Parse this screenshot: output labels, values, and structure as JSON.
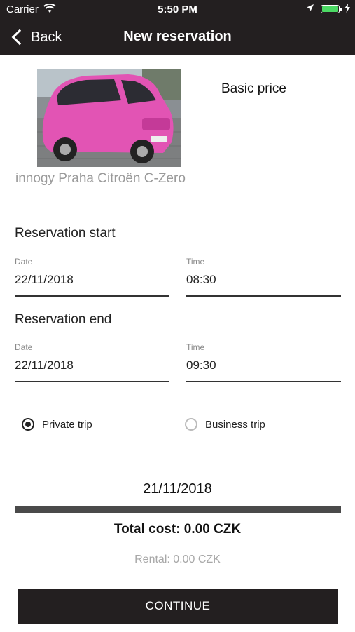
{
  "status_bar": {
    "carrier": "Carrier",
    "time": "5:50 PM",
    "battery_color": "#4cd964",
    "wifi_icon": "wifi-icon",
    "location_icon": "location-arrow-icon",
    "charging_icon": "bolt-icon"
  },
  "nav": {
    "back_label": "Back",
    "title": "New reservation",
    "back_icon": "chevron-left-icon",
    "bar_color": "#231f20"
  },
  "vehicle": {
    "name": "innogy Praha Citroën C-Zero",
    "price_label": "Basic price",
    "body_color": "#e254b4"
  },
  "reservation_start": {
    "heading": "Reservation start",
    "date_label": "Date",
    "date_value": "22/11/2018",
    "time_label": "Time",
    "time_value": "08:30"
  },
  "reservation_end": {
    "heading": "Reservation end",
    "date_label": "Date",
    "date_value": "22/11/2018",
    "time_label": "Time",
    "time_value": "09:30"
  },
  "trip_type": {
    "options": [
      {
        "label": "Private trip",
        "selected": true
      },
      {
        "label": "Business trip",
        "selected": false
      }
    ]
  },
  "calendar": {
    "date": "21/11/2018"
  },
  "summary": {
    "total": "Total cost: 0.00 CZK",
    "rental": "Rental: 0.00 CZK",
    "continue_label": "CONTINUE"
  }
}
